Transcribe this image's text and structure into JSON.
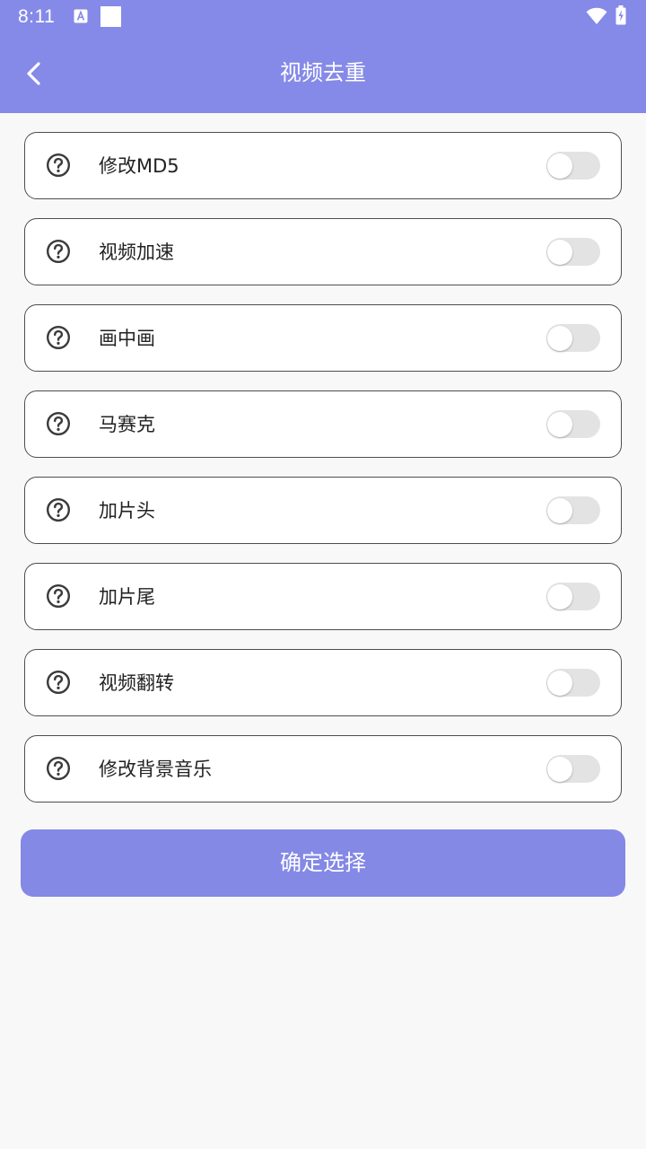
{
  "status_bar": {
    "time": "8:11",
    "icons": [
      "text-a-notification-icon",
      "notification-square-icon",
      "wifi-icon",
      "battery-charging-icon"
    ]
  },
  "header": {
    "title": "视频去重",
    "back_icon": "chevron-left-icon"
  },
  "options": [
    {
      "label": "修改MD5",
      "enabled": false
    },
    {
      "label": "视频加速",
      "enabled": false
    },
    {
      "label": "画中画",
      "enabled": false
    },
    {
      "label": "马赛克",
      "enabled": false
    },
    {
      "label": "加片头",
      "enabled": false
    },
    {
      "label": "加片尾",
      "enabled": false
    },
    {
      "label": "视频翻转",
      "enabled": false
    },
    {
      "label": "修改背景音乐",
      "enabled": false
    }
  ],
  "confirm_label": "确定选择",
  "colors": {
    "primary": "#858ae8",
    "background": "#f9f8f8",
    "card_border": "#4e4e4e",
    "toggle_off": "#e3e3e3"
  }
}
